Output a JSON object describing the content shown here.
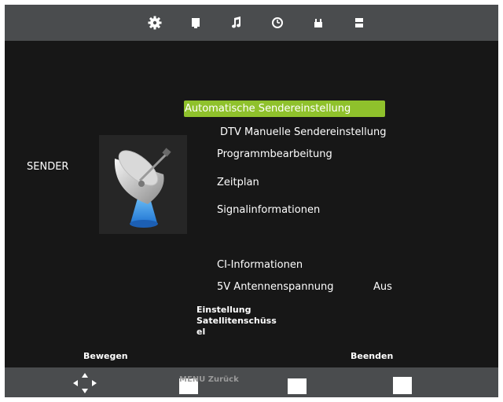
{
  "top_tabs": [
    {
      "icon": "gear-icon",
      "active": true
    },
    {
      "icon": "picture-icon"
    },
    {
      "icon": "music-note-icon"
    },
    {
      "icon": "clock-icon"
    },
    {
      "icon": "lock-icon"
    },
    {
      "icon": "settings-panel-icon"
    }
  ],
  "section_label": "SENDER",
  "menu": {
    "items": [
      {
        "label": "Automatische Sendereinstellung",
        "selected": true
      },
      {
        "label": "DTV Manuelle Sendereinstellung"
      },
      {
        "label": "Programmbearbeitung"
      },
      {
        "label": "Zeitplan"
      },
      {
        "label": "Signalinformationen"
      },
      {
        "label": "CI-Informationen"
      },
      {
        "label": "5V Antennenspannung",
        "value": "Aus"
      }
    ],
    "extra_lines": [
      "Einstellung",
      "Satellitenschüss",
      "el"
    ]
  },
  "footer": {
    "move_label": "Bewegen",
    "exit_label": "Beenden",
    "menu_back_label": "MENU Zurück"
  },
  "colors": {
    "highlight": "#8fc12c",
    "background": "#171717",
    "bar": "#4a4c4e"
  }
}
